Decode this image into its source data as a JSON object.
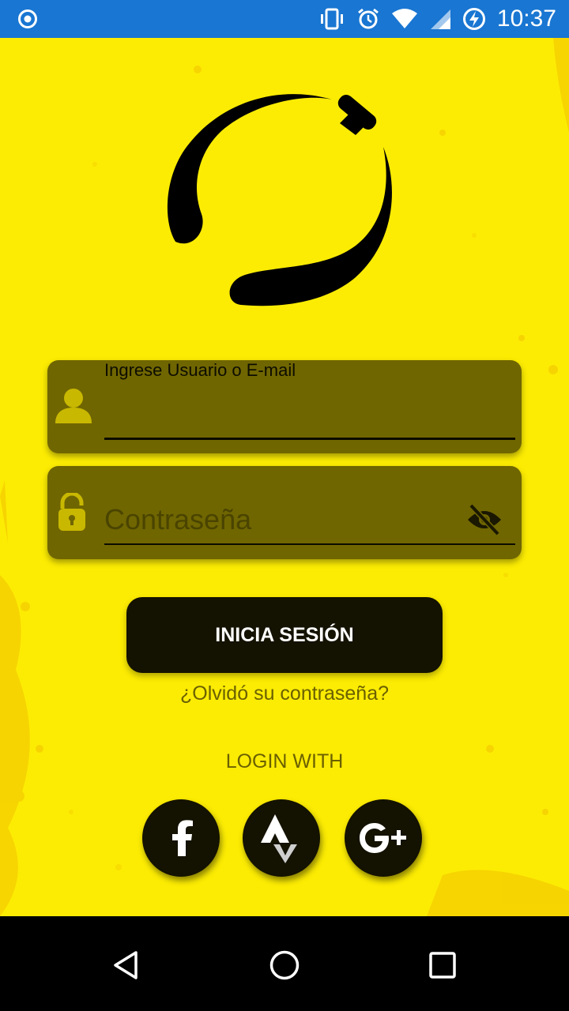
{
  "status_bar": {
    "time": "10:37",
    "icons": [
      "record-icon",
      "vibrate-icon",
      "alarm-icon",
      "wifi-icon",
      "signal-icon",
      "battery-charging-icon"
    ]
  },
  "logo": {
    "icon": "circle-logo-icon"
  },
  "username_field": {
    "label": "Ingrese Usuario o E-mail",
    "value": "",
    "icon": "user-icon"
  },
  "password_field": {
    "placeholder": "Contraseña",
    "value": "",
    "icon": "lock-icon",
    "toggle_icon": "eye-off-icon"
  },
  "login_button": {
    "label": "INICIA SESIÓN"
  },
  "forgot_link": {
    "label": "¿Olvidó su contraseña?"
  },
  "login_with": {
    "label": "LOGIN WITH"
  },
  "social": [
    {
      "name": "facebook",
      "icon": "facebook-icon"
    },
    {
      "name": "strava",
      "icon": "strava-icon"
    },
    {
      "name": "google-plus",
      "icon": "google-plus-icon"
    }
  ],
  "nav_bar": {
    "icons": [
      "back-icon",
      "home-icon",
      "recent-apps-icon"
    ]
  },
  "colors": {
    "status_bar": "#1976d2",
    "background": "#fcec03",
    "field": "#706600",
    "button": "#141200",
    "muted_text": "#6b6000"
  }
}
